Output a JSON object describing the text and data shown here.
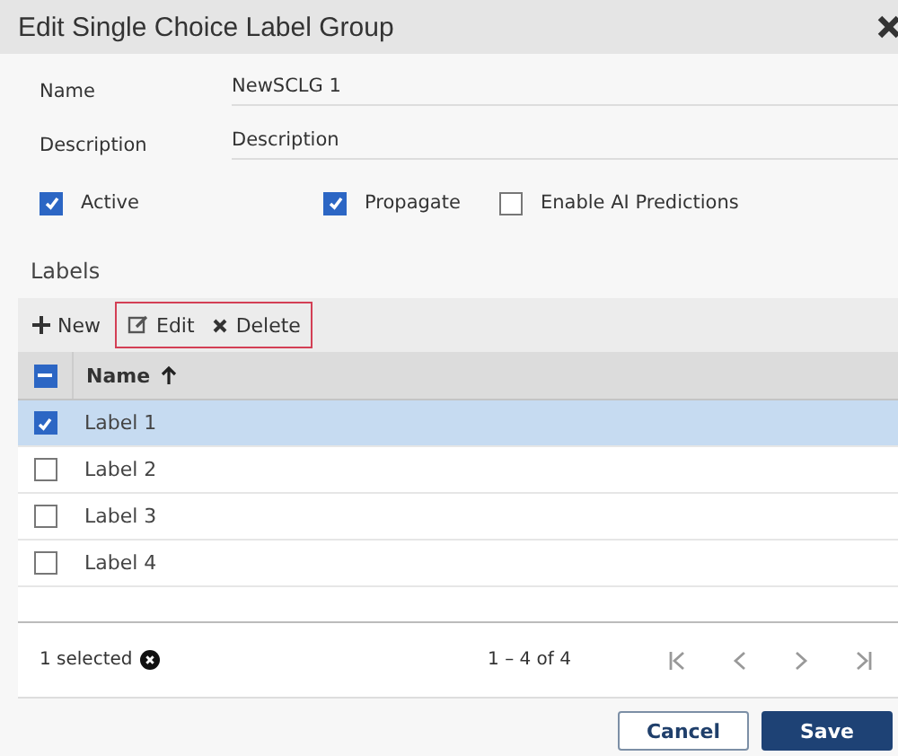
{
  "window": {
    "title": "Edit Single Choice Label Group"
  },
  "fields": [
    {
      "label": "Name",
      "value": "NewSCLG 1"
    },
    {
      "label": "Description",
      "placeholder": "Description"
    }
  ],
  "options": [
    {
      "label": "Active",
      "checked": true
    },
    {
      "label": "Propagate",
      "checked": true
    },
    {
      "label": "Enable AI Predictions",
      "checked": false
    }
  ],
  "section_title": "Labels",
  "toolbar": [
    {
      "label": "New",
      "kind": "add",
      "highlighted": false
    },
    {
      "label": "Edit",
      "kind": "edit",
      "highlighted": true
    },
    {
      "label": "Delete",
      "kind": "delete",
      "highlighted": true
    }
  ],
  "table": {
    "column": "Name",
    "sorted_ascending": true,
    "header_partially_checked": true,
    "rows": [
      {
        "name": "Label 1",
        "selected": true
      },
      {
        "name": "Label 2",
        "selected": false
      },
      {
        "name": "Label 3",
        "selected": false
      },
      {
        "name": "Label 4",
        "selected": false
      }
    ]
  },
  "footer": {
    "selection": "1 selected",
    "range": "1 – 4 of 4"
  },
  "buttons": [
    {
      "label": "Cancel",
      "kind": "secondary"
    },
    {
      "label": "Save",
      "kind": "primary"
    }
  ]
}
